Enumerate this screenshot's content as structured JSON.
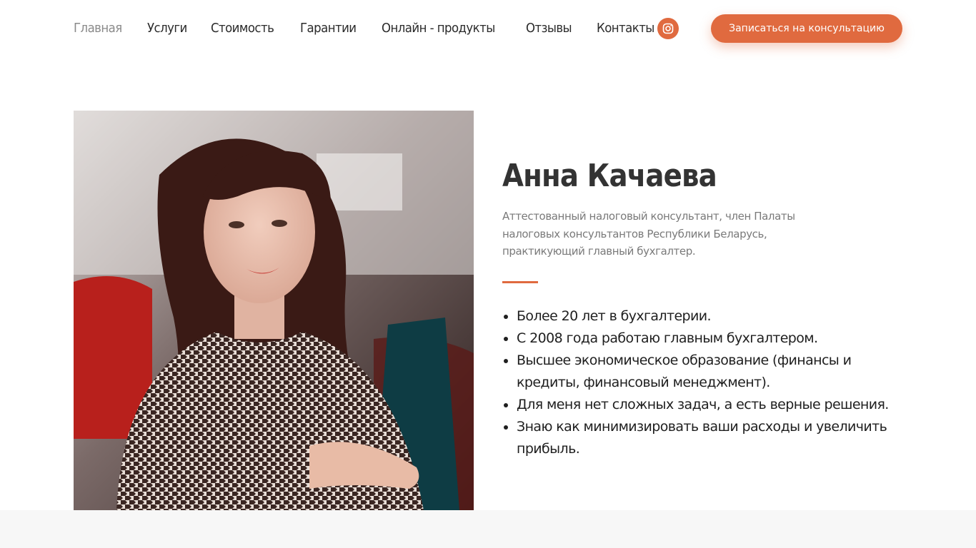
{
  "nav": {
    "items": [
      {
        "label": "Главная",
        "active": true
      },
      {
        "label": "Услуги"
      },
      {
        "label": "Стоимость"
      },
      {
        "label": "Гарантии"
      },
      {
        "label": "Онлайн - продукты"
      },
      {
        "label": "Отзывы"
      },
      {
        "label": "Контакты"
      }
    ]
  },
  "header": {
    "instagram_icon": "instagram-icon",
    "cta_label": "Записаться на консультацию"
  },
  "profile": {
    "name": "Анна Качаева",
    "description": "Аттестованный налоговый консультант, член Палаты налоговых консультантов Республики Беларусь, практикующий главный бухгалтер.",
    "facts": [
      "Более 20 лет в бухгалтерии.",
      "С 2008 года работаю главным бухгалтером.",
      "Высшее экономическое образование (финансы и кредиты, финансовый менеджмент).",
      "Для меня нет сложных задач, а есть верные решения.",
      "Знаю как минимизировать ваши расходы и увеличить прибыль."
    ]
  },
  "colors": {
    "accent": "#e06a3f",
    "text_dark": "#333333",
    "text_muted": "#7a7a7a",
    "nav_active": "#8a8a8a",
    "band": "#f7f7f7"
  }
}
